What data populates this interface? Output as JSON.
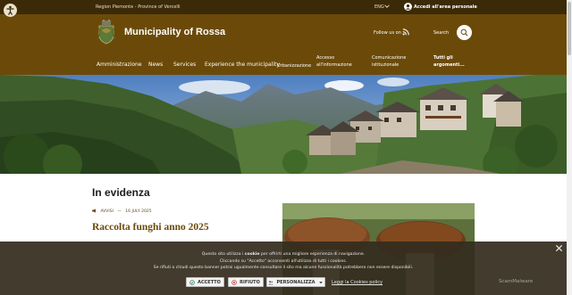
{
  "topbar": {
    "region": "Region Piemonte - Province of Vercelli",
    "language": "ENG",
    "login": "Accedi all'area personale"
  },
  "header": {
    "title": "Municipality of Rossa",
    "follow_label": "Follow us on",
    "search_label": "Search"
  },
  "nav": {
    "items": [
      "Amministrazione",
      "News",
      "Services",
      "Experience the municipality"
    ],
    "secondary": [
      "Urbanizzazione",
      "Accesso all'informazione",
      "Comunicazione istituzionale",
      "Tutti gli argomenti..."
    ],
    "secondary_lines": {
      "accesso": [
        "Accesso",
        "all'informazione"
      ],
      "comunicazione": [
        "Comunicazione",
        "istituzionale"
      ],
      "tutti": [
        "Tutti gli",
        "argomenti..."
      ]
    }
  },
  "featured": {
    "section_title": "In evidenza",
    "category": "AVVISI",
    "separator": "—",
    "date": "16 JULY 2025",
    "article_title": "Raccolta funghi anno 2025"
  },
  "cookie_banner": {
    "line1_pre": "Questo sito utilizza i ",
    "line1_bold": "cookie",
    "line1_post": " per offrirti una migliore esperienza di navigazione.",
    "line2": "Cliccando su \"Accetto\" acconsenti all'utilizzo di tutti i cookies.",
    "line3": "Se rifiuti o chiudi questo banner potrai ugualmente consultare il sito ma alcune funzionalità potrebbero non essere disponibili.",
    "accept": "ACCETTO",
    "reject": "RIFIUTO",
    "customize": "PERSONALIZZA",
    "policy": "Leggi la Cookies policy",
    "brand": "ScamMalware"
  },
  "colors": {
    "topbar": "#3b2a07",
    "header": "#6b4a09",
    "accent": "#6b4a09",
    "banner": "#342c1e"
  }
}
